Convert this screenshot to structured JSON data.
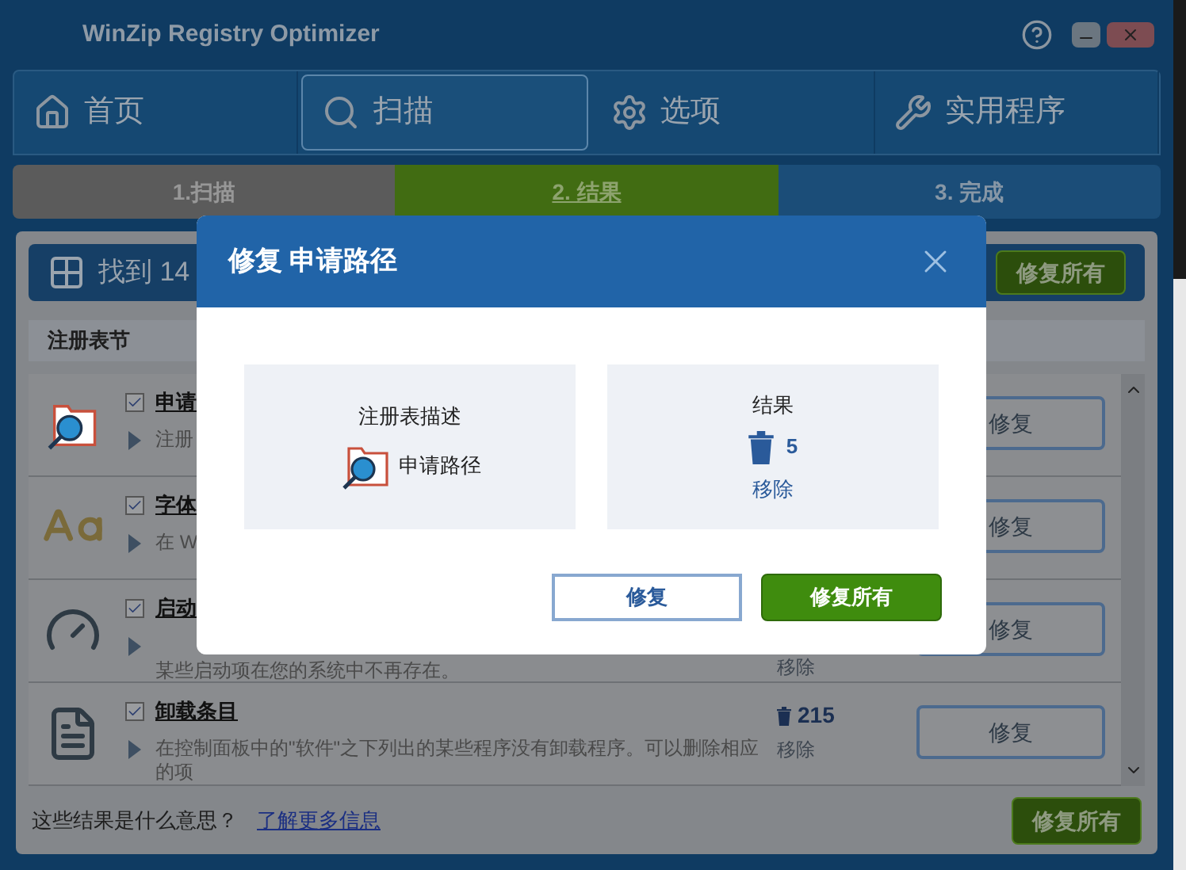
{
  "window": {
    "title": "WinZip Registry Optimizer"
  },
  "nav_tabs": [
    {
      "kind": "home",
      "label": "首页",
      "selected": false
    },
    {
      "kind": "scan",
      "label": "扫描",
      "selected": true
    },
    {
      "kind": "options",
      "label": "选项",
      "selected": false
    },
    {
      "kind": "tools",
      "label": "实用程序",
      "selected": false
    }
  ],
  "steps": [
    {
      "label": "1.扫描",
      "selected": false
    },
    {
      "label": "2. 结果",
      "selected": true
    },
    {
      "label": "3. 完成",
      "selected": false
    }
  ],
  "results_header": {
    "title": "找到 14",
    "button": "修复所有"
  },
  "table": {
    "column": "注册表节",
    "rows": [
      {
        "kind": "folder",
        "checked": true,
        "title": "申请",
        "description": "注册",
        "button": "修复"
      },
      {
        "kind": "font",
        "checked": true,
        "title": "字体",
        "description": "在 W",
        "button": "修复"
      },
      {
        "kind": "startup",
        "checked": true,
        "title": "启动",
        "description": "某些启动项在您的系统中不再存在。",
        "action": "移除",
        "button": "修复"
      },
      {
        "kind": "uninstall",
        "checked": true,
        "title": "卸载条目",
        "description": "在控制面板中的\"软件\"之下列出的某些程序没有卸载程序。可以删除相应的项",
        "count": "215",
        "action": "移除",
        "button": "修复"
      }
    ]
  },
  "footer": {
    "question": "这些结果是什么意思？",
    "link": "了解更多信息",
    "button": "修复所有"
  },
  "dialog": {
    "title": "修复 申请路径",
    "description_panel": {
      "heading": "注册表描述",
      "item": "申请路径"
    },
    "result_panel": {
      "heading": "结果",
      "count": "5",
      "action": "移除"
    },
    "buttons": [
      {
        "kind": "outline",
        "label": "修复"
      },
      {
        "kind": "primary",
        "label": "修复所有"
      }
    ]
  }
}
